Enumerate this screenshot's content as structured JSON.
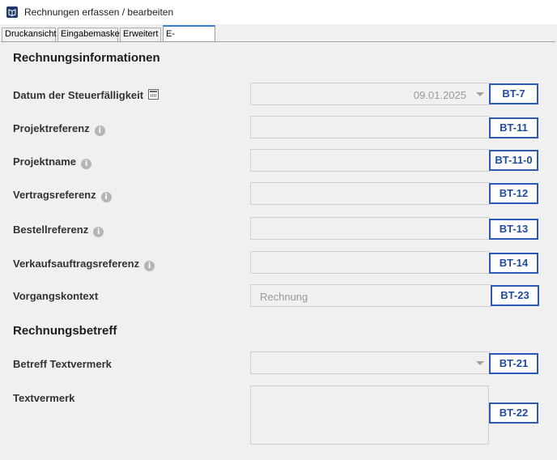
{
  "window": {
    "title": "Rechnungen erfassen / bearbeiten",
    "icon": "book-icon"
  },
  "tabs": [
    {
      "label": "Druckansicht",
      "active": false
    },
    {
      "label": "Eingabemaske",
      "active": false
    },
    {
      "label": "Erweitert",
      "active": false
    },
    {
      "label": "E-Rechnung",
      "active": true
    }
  ],
  "section_invoice": {
    "title": "Rechnungsinformationen",
    "fields": [
      {
        "label": "Datum der Steuerfälligkeit",
        "icon": "calendar-icon",
        "value": "09.01.2025",
        "type": "dropdown",
        "code": "BT-7"
      },
      {
        "label": "Projektreferenz",
        "icon": "info-icon",
        "value": "",
        "type": "text",
        "code": "BT-11"
      },
      {
        "label": "Projektname",
        "icon": "info-icon",
        "value": "",
        "type": "text",
        "code": "BT-11-0"
      },
      {
        "label": "Vertragsreferenz",
        "icon": "info-icon",
        "value": "",
        "type": "text",
        "code": "BT-12"
      },
      {
        "label": "Bestellreferenz",
        "icon": "info-icon",
        "value": "",
        "type": "text",
        "code": "BT-13"
      },
      {
        "label": "Verkaufsauftragsreferenz",
        "icon": "info-icon",
        "value": "",
        "type": "text",
        "code": "BT-14"
      },
      {
        "label": "Vorgangskontext",
        "icon": "",
        "value": "Rechnung",
        "type": "text",
        "code": "BT-23"
      }
    ]
  },
  "section_subject": {
    "title": "Rechnungsbetreff",
    "fields": [
      {
        "label": "Betreff Textvermerk",
        "value": "",
        "type": "dropdown",
        "code": "BT-21"
      },
      {
        "label": "Textvermerk",
        "value": "",
        "type": "textarea",
        "code": "BT-22"
      }
    ]
  },
  "info_glyph": "i"
}
